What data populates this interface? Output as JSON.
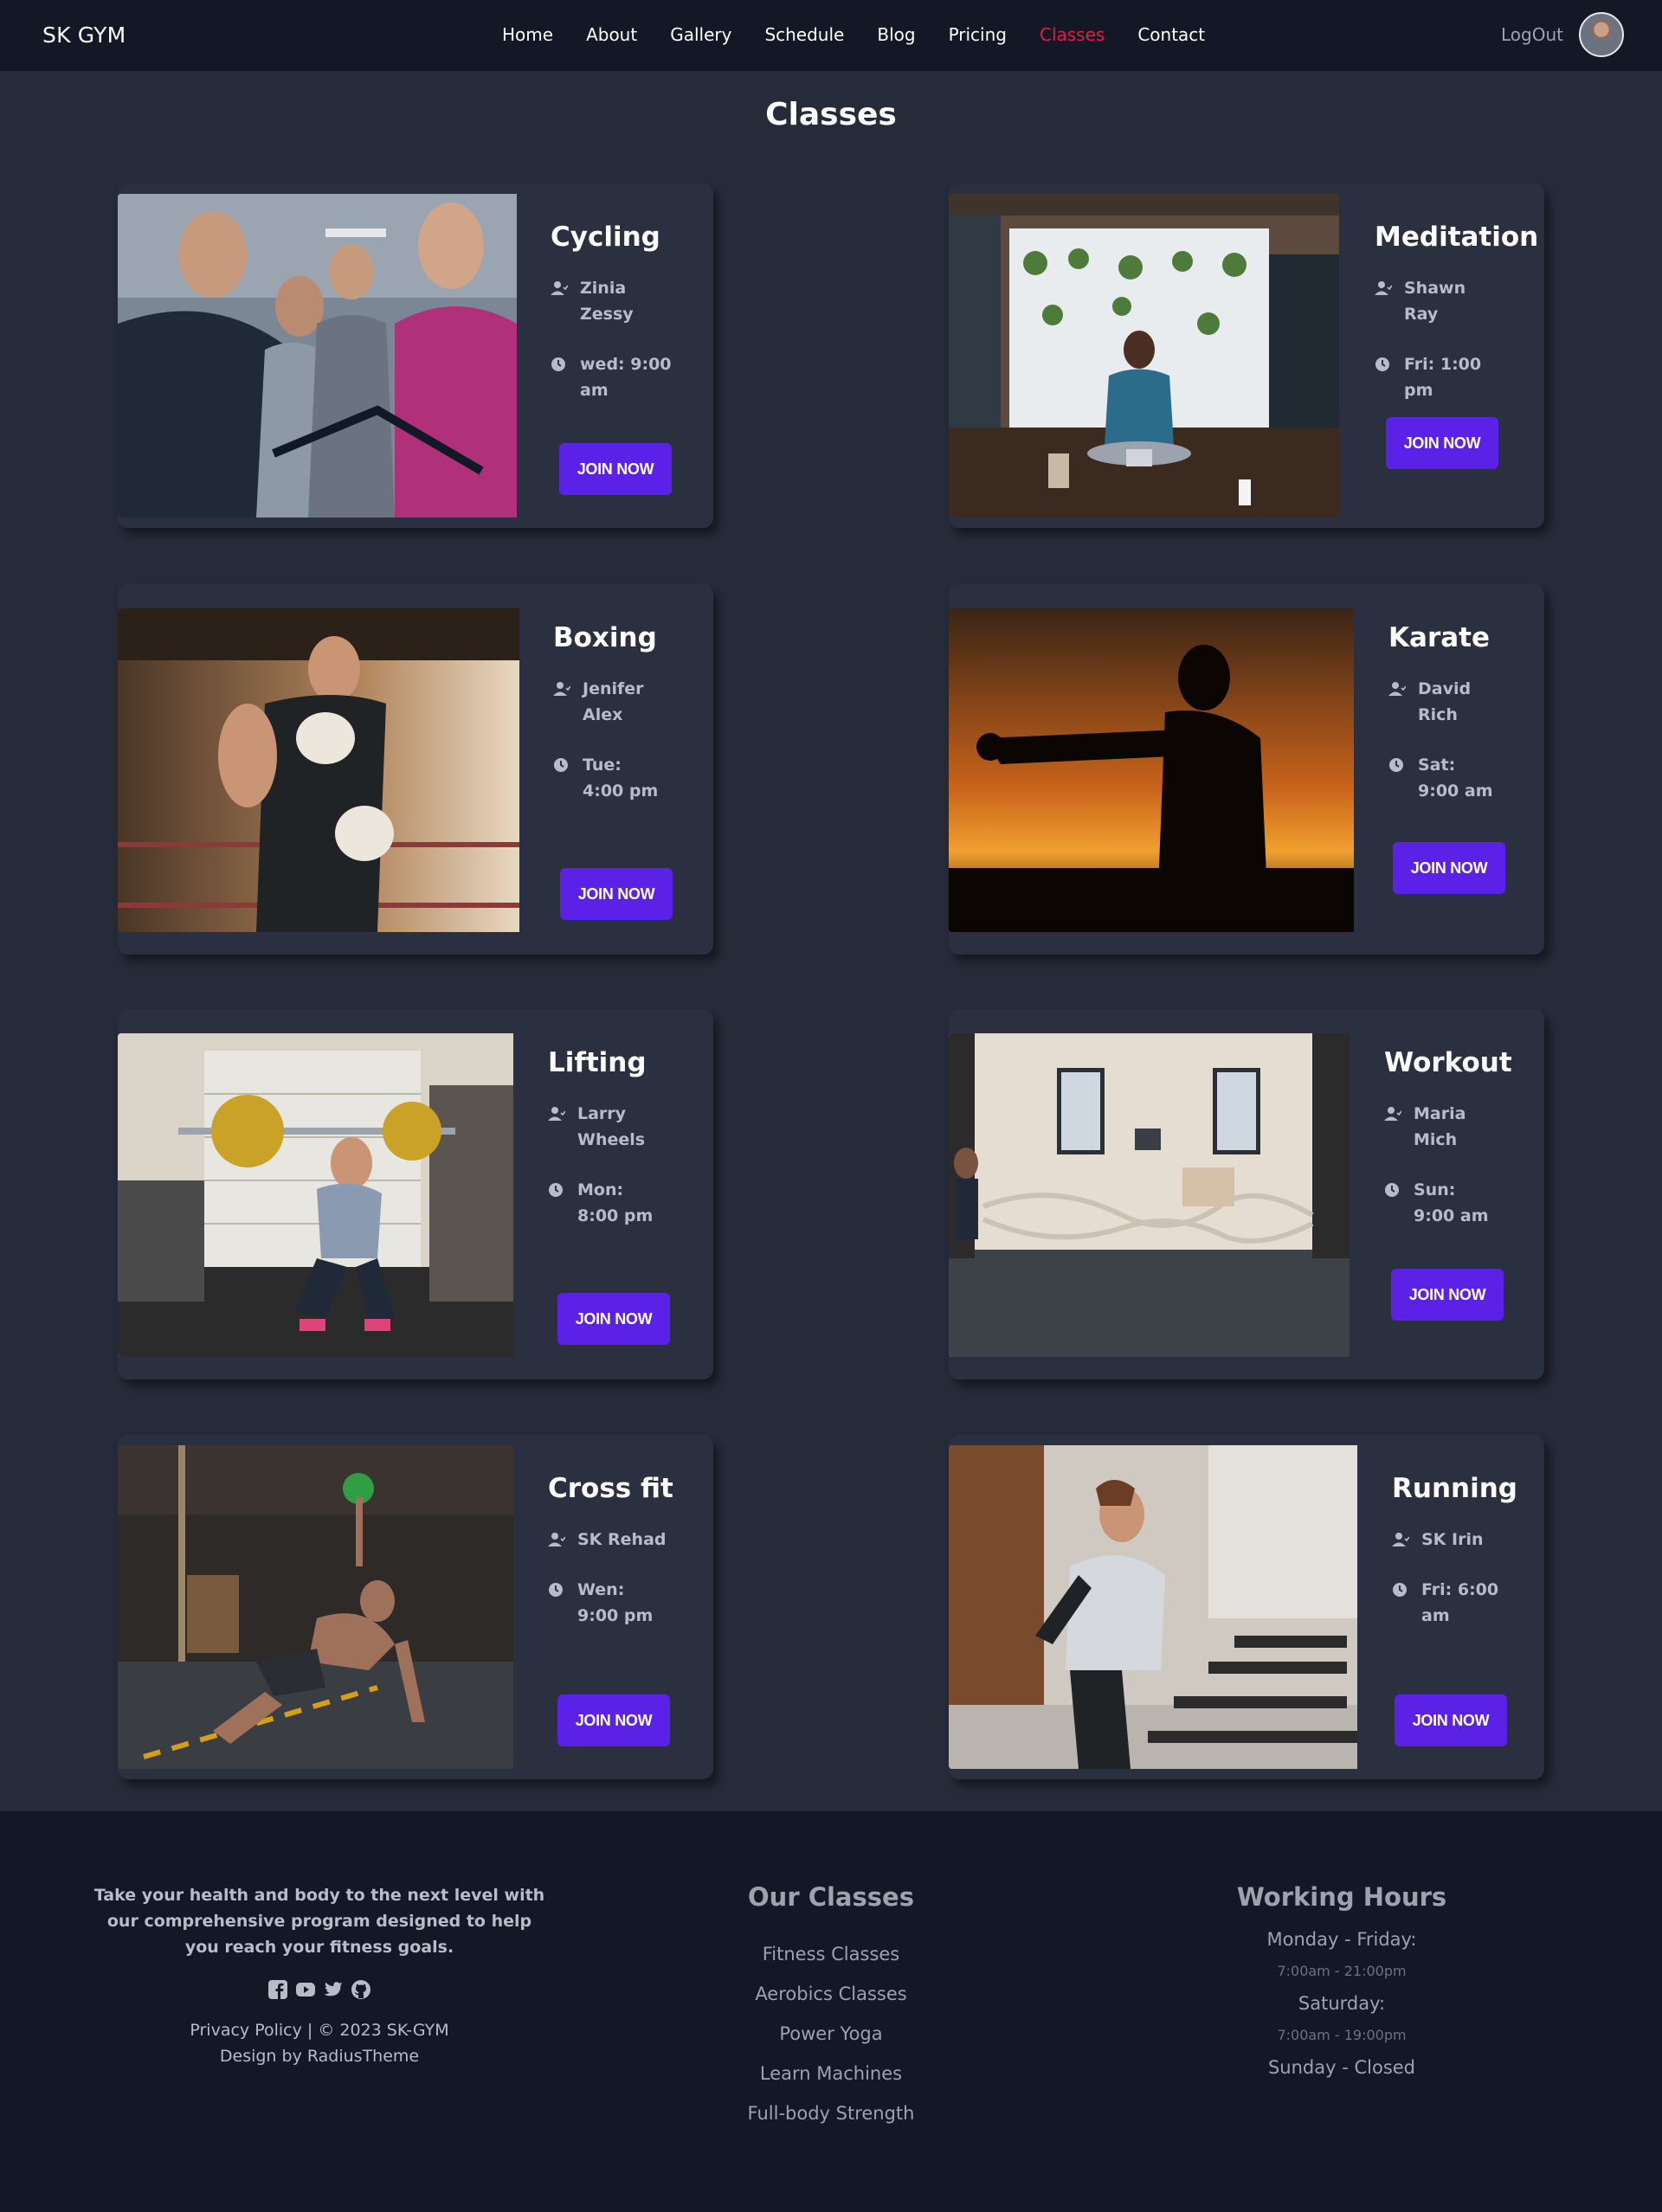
{
  "nav": {
    "brand": "SK GYM",
    "links": [
      "Home",
      "About",
      "Gallery",
      "Schedule",
      "Blog",
      "Pricing",
      "Classes",
      "Contact"
    ],
    "active": "Classes",
    "logout": "LogOut"
  },
  "page": {
    "title": "Classes"
  },
  "classes": [
    {
      "name": "Cycling",
      "trainer": "Zinia Zessy",
      "time": "wed: 9:00 am",
      "join": "JOIN NOW"
    },
    {
      "name": "Meditation",
      "trainer": "Shawn Ray",
      "time": "Fri: 1:00 pm",
      "join": "JOIN NOW"
    },
    {
      "name": "Boxing",
      "trainer": "Jenifer Alex",
      "time": "Tue: 4:00 pm",
      "join": "JOIN NOW"
    },
    {
      "name": "Karate",
      "trainer": "David Rich",
      "time": "Sat: 9:00 am",
      "join": "JOIN NOW"
    },
    {
      "name": "Lifting",
      "trainer": "Larry Wheels",
      "time": "Mon: 8:00 pm",
      "join": "JOIN NOW"
    },
    {
      "name": "Workout",
      "trainer": "Maria Mich",
      "time": "Sun: 9:00 am",
      "join": "JOIN NOW"
    },
    {
      "name": "Cross fit",
      "trainer": "SK Rehad",
      "time": "Wen: 9:00 pm",
      "join": "JOIN NOW"
    },
    {
      "name": "Running",
      "trainer": "SK Irin",
      "time": "Fri: 6:00 am",
      "join": "JOIN NOW"
    }
  ],
  "icons": {
    "trainer": "user-icon",
    "time": "clock-icon",
    "socials": [
      "facebook-icon",
      "youtube-icon",
      "twitter-icon",
      "github-icon"
    ]
  },
  "footer": {
    "tagline": "Take your health and body to the next level with our comprehensive program designed to help you reach your fitness goals.",
    "copyright": "Privacy Policy | © 2023 SK-GYM",
    "credit": "Design by RadiusTheme",
    "classes_title": "Our Classes",
    "class_links": [
      "Fitness Classes",
      "Aerobics Classes",
      "Power Yoga",
      "Learn Machines",
      "Full-body Strength"
    ],
    "hours_title": "Working Hours",
    "hours": {
      "weekday_label": "Monday - Friday:",
      "weekday_time": "7:00am - 21:00pm",
      "saturday_label": "Saturday:",
      "saturday_time": "7:00am - 19:00pm",
      "sunday": "Sunday - Closed"
    }
  },
  "colors": {
    "background": "#262b39",
    "navbar": "#131726",
    "card": "#2b3040",
    "accent": "#5b21e6",
    "active_link": "#e11d48"
  }
}
